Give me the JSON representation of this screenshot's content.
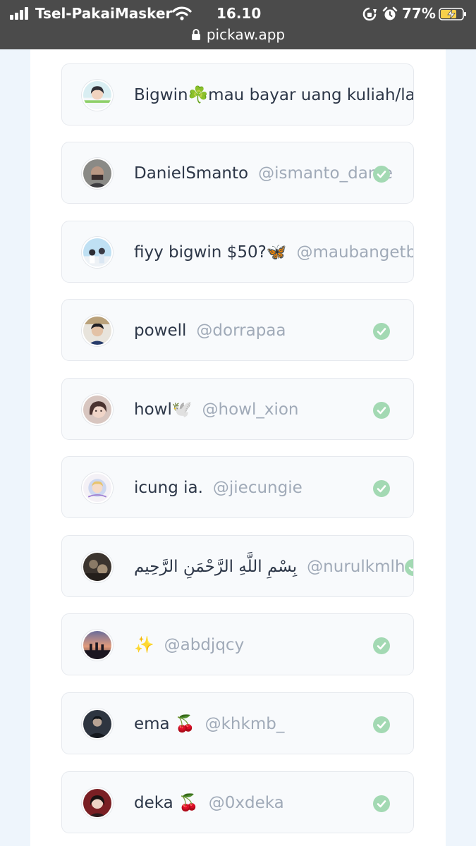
{
  "status_bar": {
    "carrier": "Tsel-PakaiMasker",
    "time": "16.10",
    "battery": "77%",
    "url": "pickaw.app"
  },
  "colors": {
    "status_bar_bg": "#4b4b4b",
    "page_bg": "#eef5fc",
    "card_bg": "#f8fafc",
    "check_green": "#a3d9b3",
    "name_text": "#2d3748",
    "handle_text": "#a0aab8"
  },
  "entries": [
    {
      "name": "Bigwin☘️mau bayar uang kuliah/lap",
      "handle": "",
      "avatar": "avatar-photo",
      "verified": false
    },
    {
      "name": "DanielSmanto",
      "handle": "@ismanto_danie",
      "avatar": "avatar-photo",
      "verified": true
    },
    {
      "name": "fiyy bigwin $50?🦋",
      "handle": "@maubangetb",
      "avatar": "avatar-photo",
      "verified": false
    },
    {
      "name": "powell",
      "handle": "@dorrapaa",
      "avatar": "avatar-photo",
      "verified": true
    },
    {
      "name": "howl🕊️",
      "handle": "@howl_xion",
      "avatar": "avatar-photo",
      "verified": true
    },
    {
      "name": "icung ia.",
      "handle": "@jiecungie",
      "avatar": "avatar-photo",
      "verified": true
    },
    {
      "name": "بِسْمِ اللَّهِ الرَّحْمَنِ الرَّحِيم",
      "handle": "@nurulkmlh",
      "avatar": "avatar-photo",
      "verified": true
    },
    {
      "name": "✨",
      "handle": "@abdjqcy",
      "avatar": "avatar-photo",
      "verified": true
    },
    {
      "name": "ema 🍒",
      "handle": "@khkmb_",
      "avatar": "avatar-photo",
      "verified": true
    },
    {
      "name": "deka 🍒",
      "handle": "@0xdeka",
      "avatar": "avatar-photo",
      "verified": true
    }
  ]
}
